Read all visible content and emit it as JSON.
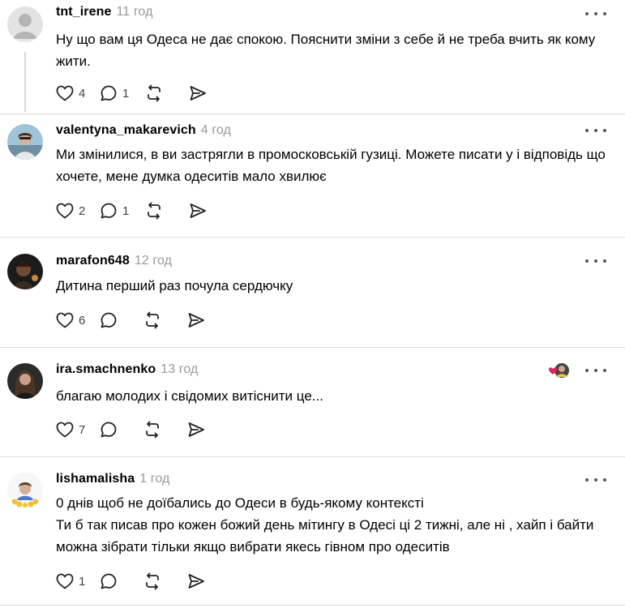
{
  "posts": [
    {
      "username": "tnt_irene",
      "time": "11 год",
      "text": "Ну що вам ця Одеса не дає спокою. Пояснити зміни з себе й не треба вчить як кому жити.",
      "likes": "4",
      "replies": "1"
    },
    {
      "username": "valentyna_makarevich",
      "time": "4 год",
      "text": "Ми змінилися, в ви застрягли в промосковській гузиці. Можете писати у і відповідь що хочете, мене думка одеситів мало хвилює",
      "likes": "2",
      "replies": "1"
    },
    {
      "username": "marafon648",
      "time": "12 год",
      "text": "Дитина перший раз почула сердючку",
      "likes": "6",
      "replies": ""
    },
    {
      "username": "ira.smachnenko",
      "time": "13 год",
      "text": "благаю молодих і свідомих витіснити це...",
      "likes": "7",
      "replies": ""
    },
    {
      "username": "lishamalisha",
      "time": "1 год",
      "text_lines": [
        "0 днів щоб не доїбались до Одеси в будь-якому контексті",
        "Ти б так писав про кожен божий день мітингу в Одесі ці 2 тижні, але ні , хайп і байти можна зібрати тільки якщо вибрати якесь гівном про одеситів"
      ],
      "likes": "1",
      "replies": ""
    }
  ],
  "icons": {
    "like": "heart-icon",
    "reply": "comment-icon",
    "repost": "repost-icon",
    "share": "send-icon",
    "more": "more-horizontal-icon"
  },
  "colors": {
    "text": "#000000",
    "muted": "#999999",
    "divider": "#dcdcdc",
    "heart_red": "#e0245e"
  }
}
